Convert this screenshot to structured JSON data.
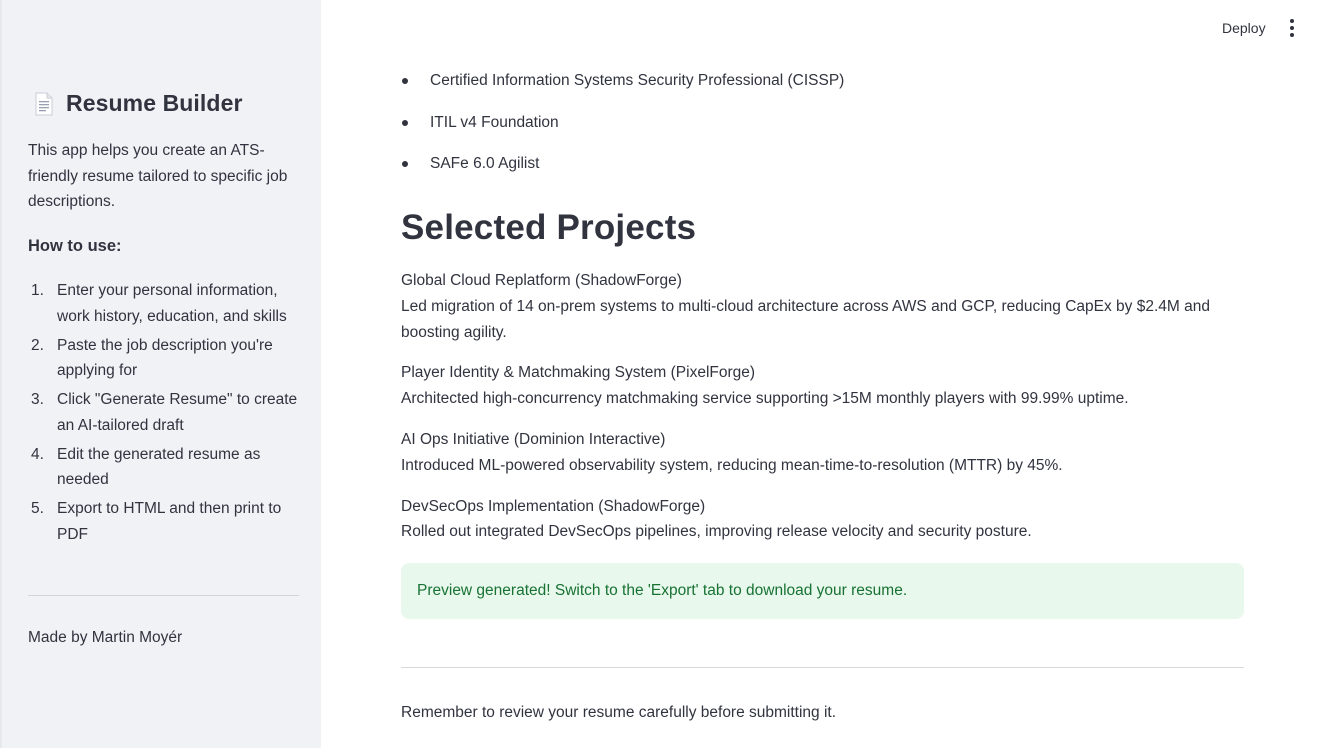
{
  "sidebar": {
    "icon": "document-icon",
    "title": "Resume Builder",
    "description": "This app helps you create an ATS-friendly resume tailored to specific job descriptions.",
    "how_to_heading": "How to use:",
    "steps": [
      {
        "num": "1.",
        "text": "Enter your personal information, work history, education, and skills"
      },
      {
        "num": "2.",
        "text": "Paste the job description you're applying for"
      },
      {
        "num": "3.",
        "text": "Click \"Generate Resume\" to create an AI-tailored draft"
      },
      {
        "num": "4.",
        "text": "Edit the generated resume as needed"
      },
      {
        "num": "5.",
        "text": "Export to HTML and then print to PDF"
      }
    ],
    "footer": "Made by Martin Moyér"
  },
  "header": {
    "deploy_label": "Deploy",
    "menu_icon": "more-vertical-icon"
  },
  "main": {
    "certifications": [
      "Certified Information Systems Security Professional (CISSP)",
      "ITIL v4 Foundation",
      "SAFe 6.0 Agilist"
    ],
    "section_title": "Selected Projects",
    "projects": [
      {
        "name": "Global Cloud Replatform (ShadowForge)",
        "description": "Led migration of 14 on-prem systems to multi-cloud architecture across AWS and GCP, reducing CapEx by $2.4M and boosting agility."
      },
      {
        "name": "Player Identity & Matchmaking System (PixelForge)",
        "description": "Architected high-concurrency matchmaking service supporting >15M monthly players with 99.99% uptime."
      },
      {
        "name": "AI Ops Initiative (Dominion Interactive)",
        "description": "Introduced ML-powered observability system, reducing mean-time-to-resolution (MTTR) by 45%."
      },
      {
        "name": "DevSecOps Implementation (ShadowForge)",
        "description": "Rolled out integrated DevSecOps pipelines, improving release velocity and security posture."
      }
    ],
    "success_message": "Preview generated! Switch to the 'Export' tab to download your resume.",
    "reminder": "Remember to review your resume carefully before submitting it."
  },
  "colors": {
    "sidebar_bg": "#f0f2f6",
    "text": "#31333f",
    "success_bg": "#e8f8ec",
    "success_text": "#177233"
  }
}
